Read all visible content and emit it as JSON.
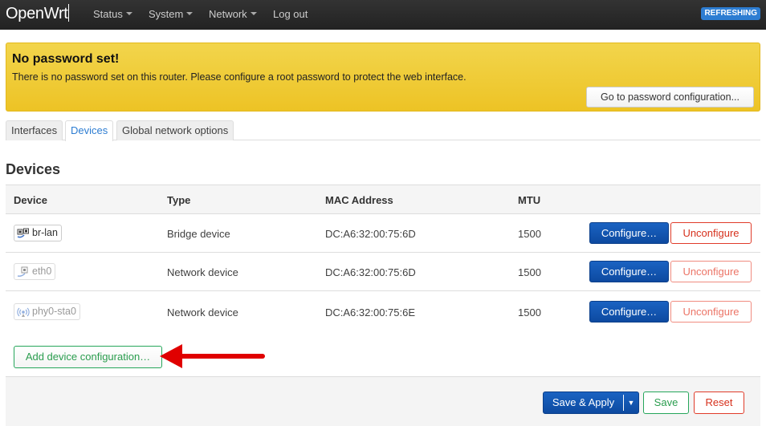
{
  "navbar": {
    "brand": "OpenWrt",
    "menu": [
      {
        "label": "Status",
        "has_dropdown": true
      },
      {
        "label": "System",
        "has_dropdown": true
      },
      {
        "label": "Network",
        "has_dropdown": true
      },
      {
        "label": "Log out",
        "has_dropdown": false
      }
    ],
    "status_badge": "REFRESHING"
  },
  "alert": {
    "title": "No password set!",
    "message": "There is no password set on this router. Please configure a root password to protect the web interface.",
    "button_label": "Go to password configuration..."
  },
  "tabs": [
    {
      "label": "Interfaces",
      "active": false
    },
    {
      "label": "Devices",
      "active": true
    },
    {
      "label": "Global network options",
      "active": false
    }
  ],
  "section": {
    "title": "Devices"
  },
  "table": {
    "columns": [
      "Device",
      "Type",
      "MAC Address",
      "MTU"
    ],
    "rows": [
      {
        "device": "br-lan",
        "icon": "bridge-icon",
        "configured": true,
        "type": "Bridge device",
        "mac": "DC:A6:32:00:75:6D",
        "mtu": "1500",
        "configure_label": "Configure…",
        "unconfigure_label": "Unconfigure"
      },
      {
        "device": "eth0",
        "icon": "ethernet-icon",
        "configured": false,
        "type": "Network device",
        "mac": "DC:A6:32:00:75:6D",
        "mtu": "1500",
        "configure_label": "Configure…",
        "unconfigure_label": "Unconfigure"
      },
      {
        "device": "phy0-sta0",
        "icon": "wireless-icon",
        "configured": false,
        "type": "Network device",
        "mac": "DC:A6:32:00:75:6E",
        "mtu": "1500",
        "configure_label": "Configure…",
        "unconfigure_label": "Unconfigure"
      }
    ]
  },
  "add_button_label": "Add device configuration…",
  "footer": {
    "save_apply_label": "Save & Apply",
    "save_label": "Save",
    "reset_label": "Reset"
  },
  "colors": {
    "primary": "#0d4aa0",
    "positive": "#26a65b",
    "negative": "#e03c2a",
    "warning": "#edc325",
    "annotation_arrow": "#e00000"
  }
}
